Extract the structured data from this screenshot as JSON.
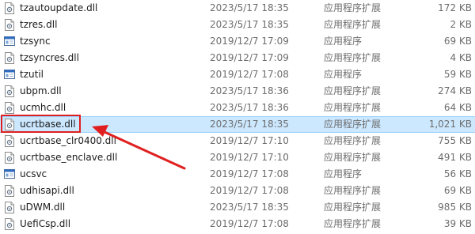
{
  "files": [
    {
      "name": "tzautoupdate.dll",
      "date": "2023/5/17 18:35",
      "type": "应用程序扩展",
      "size": "172 KB",
      "icon": "dll-file-icon"
    },
    {
      "name": "tzres.dll",
      "date": "2023/5/17 18:35",
      "type": "应用程序扩展",
      "size": "2 KB",
      "icon": "dll-file-icon"
    },
    {
      "name": "tzsync",
      "date": "2019/12/7 17:09",
      "type": "应用程序",
      "size": "69 KB",
      "icon": "exe-app-icon"
    },
    {
      "name": "tzsyncres.dll",
      "date": "2019/12/7 17:09",
      "type": "应用程序扩展",
      "size": "4 KB",
      "icon": "dll-file-icon"
    },
    {
      "name": "tzutil",
      "date": "2019/12/7 17:08",
      "type": "应用程序",
      "size": "59 KB",
      "icon": "exe-app-icon"
    },
    {
      "name": "ubpm.dll",
      "date": "2023/5/17 18:36",
      "type": "应用程序扩展",
      "size": "274 KB",
      "icon": "dll-file-icon"
    },
    {
      "name": "ucmhc.dll",
      "date": "2023/5/17 18:36",
      "type": "应用程序扩展",
      "size": "64 KB",
      "icon": "dll-file-icon"
    },
    {
      "name": "ucrtbase.dll",
      "date": "2023/5/17 18:35",
      "type": "应用程序扩展",
      "size": "1,021 KB",
      "icon": "dll-file-icon",
      "selected": true
    },
    {
      "name": "ucrtbase_clr0400.dll",
      "date": "2019/12/7 17:10",
      "type": "应用程序扩展",
      "size": "755 KB",
      "icon": "dll-file-icon"
    },
    {
      "name": "ucrtbase_enclave.dll",
      "date": "2019/12/7 17:10",
      "type": "应用程序扩展",
      "size": "491 KB",
      "icon": "dll-file-icon"
    },
    {
      "name": "ucsvc",
      "date": "2019/12/7 17:08",
      "type": "应用程序",
      "size": "56 KB",
      "icon": "exe-app-icon"
    },
    {
      "name": "udhisapi.dll",
      "date": "2019/12/7 17:08",
      "type": "应用程序扩展",
      "size": "69 KB",
      "icon": "dll-file-icon"
    },
    {
      "name": "uDWM.dll",
      "date": "2023/5/17 18:35",
      "type": "应用程序扩展",
      "size": "985 KB",
      "icon": "dll-file-icon"
    },
    {
      "name": "UefiCsp.dll",
      "date": "2019/12/7 17:08",
      "type": "应用程序扩展",
      "size": "39 KB",
      "icon": "dll-file-icon"
    }
  ],
  "colors": {
    "selection_fill": "#cce8ff",
    "selection_border": "#99d1ff",
    "annotation_red": "#e02020",
    "secondary_text": "#6d6d6d"
  }
}
